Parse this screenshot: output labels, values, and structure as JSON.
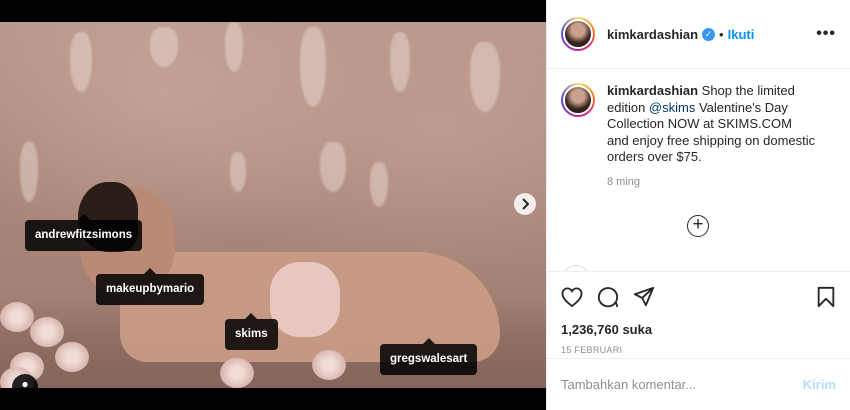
{
  "post": {
    "tags": [
      "andrewfitzsimons",
      "makeupbymario",
      "skims",
      "gregswalesart"
    ],
    "next_icon": "chevron-right-icon",
    "tags_icon": "user-icon",
    "carousel": {
      "count": 2,
      "active": 1
    }
  },
  "header": {
    "username": "kimkardashian",
    "verified": "✓",
    "separator": "•",
    "follow_label": "Ikuti",
    "more_label": "•••"
  },
  "caption": {
    "username": "kimkardashian",
    "text_before": " Shop the limited edition ",
    "mention": "@skims",
    "text_after": " Valentine's Day Collection NOW at SKIMS.COM and enjoy free shipping on domestic orders over $75.",
    "time": "8 ming"
  },
  "load_more_label": "+",
  "actions": {
    "icons": [
      "heart-icon",
      "comment-icon",
      "share-icon",
      "bookmark-icon"
    ]
  },
  "likes": "1,236,760 suka",
  "date": "15 FEBRUARI",
  "comment_box": {
    "placeholder": "Tambahkan komentar...",
    "send_label": "Kirim"
  },
  "colors": {
    "link": "#0095f6",
    "send_disabled": "#b2dffc",
    "verified": "#3897f0"
  }
}
